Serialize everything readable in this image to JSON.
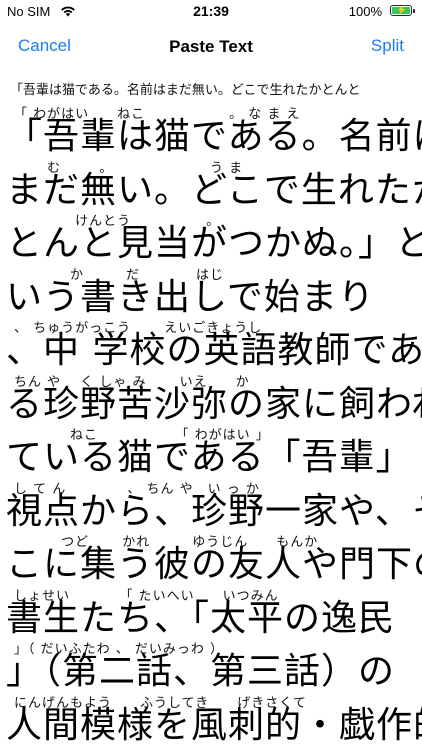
{
  "status_bar": {
    "carrier": "No SIM",
    "time": "21:39",
    "battery_percent": "100%",
    "battery_level": 1.0,
    "battery_color": "#34c759"
  },
  "navbar": {
    "cancel_label": "Cancel",
    "title": "Paste Text",
    "split_label": "Split",
    "accent_color": "#1a7cf0"
  },
  "source_text": "「吾輩は猫である。名前はまだ無い。どこで生れたかとんと",
  "lines": [
    {
      "ruby": "「 わがはい　　ねこ　　　　　　。 な ま え",
      "text": "「吾輩は猫である。名前は"
    },
    {
      "ruby": "　　 む 　　 。　　　　　　　 う ま",
      "text": "まだ無い。どこで生れたか"
    },
    {
      "ruby": "　　　　 けんとう 　　　　　。",
      "text": "とんと見当がつかぬ。」と"
    },
    {
      "ruby": "　　　　か　　　だ　　　　はじ",
      "text": "いう書き出しで始まり"
    },
    {
      "ruby": "、 ちゅうがっこう　　 えいごきょうし",
      "text": "、中 学校の英語教師であ"
    },
    {
      "ruby": " ちん や　 く しゃ み　　 いえ　　か",
      "text": "る珍野苦沙弥の家に飼われ"
    },
    {
      "ruby": "　　　　ねこ　　　　　　「 わがはい 」",
      "text": "ている猫である「吾輩」"
    },
    {
      "ruby": " し て ん　　　　 、 ちん や　い っ か",
      "text": "視点から、珍野一家や、そ"
    },
    {
      "ruby": "　　　 つど　　 かれ　　　ゆうじん　　もんか",
      "text": "こに集う彼の友人や門下の"
    },
    {
      "ruby": " しょせい　　　　「 たいへい　　いつみん",
      "text": "書生たち、「太平の逸民"
    },
    {
      "ruby": "」（ だいふたわ 、 だいみっわ ）",
      "text": "」（第二話、第三話）の"
    },
    {
      "ruby": "にんげんもよう　　ふうしてき　　げきさくて",
      "text": "人間模様を風刺的・戯作的"
    }
  ]
}
